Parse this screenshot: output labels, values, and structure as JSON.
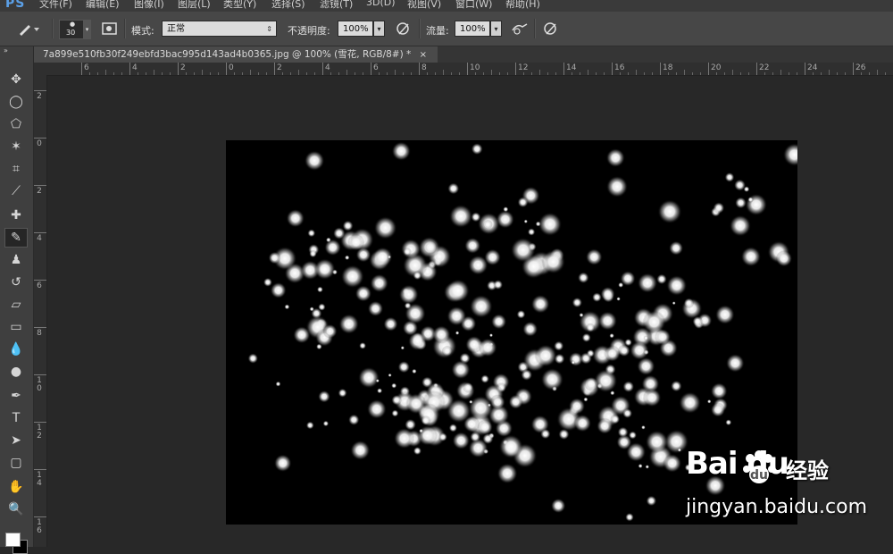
{
  "app": {
    "logo": "PS"
  },
  "menu": [
    {
      "label": "文件(F)"
    },
    {
      "label": "编辑(E)"
    },
    {
      "label": "图像(I)"
    },
    {
      "label": "图层(L)"
    },
    {
      "label": "类型(Y)"
    },
    {
      "label": "选择(S)"
    },
    {
      "label": "滤镜(T)"
    },
    {
      "label": "3D(D)"
    },
    {
      "label": "视图(V)"
    },
    {
      "label": "窗口(W)"
    },
    {
      "label": "帮助(H)"
    }
  ],
  "options": {
    "brush_size": "30",
    "mode_label": "模式:",
    "mode_value": "正常",
    "opacity_label": "不透明度:",
    "opacity_value": "100%",
    "flow_label": "流量:",
    "flow_value": "100%"
  },
  "document_tab": {
    "title": "7a899e510fb30f249ebfd3bac995d143ad4b0365.jpg @ 100% (雪花, RGB/8#) *",
    "close": "×"
  },
  "toolbar": {
    "collapse": "»",
    "tools": [
      {
        "name": "move-tool",
        "glyph": "✥"
      },
      {
        "name": "elliptical-marquee-tool",
        "glyph": "◯"
      },
      {
        "name": "polygonal-lasso-tool",
        "glyph": "⬠"
      },
      {
        "name": "magic-wand-tool",
        "glyph": "✶"
      },
      {
        "name": "crop-tool",
        "glyph": "⌗"
      },
      {
        "name": "eyedropper-tool",
        "glyph": "⟋"
      },
      {
        "name": "spot-healing-tool",
        "glyph": "✚"
      },
      {
        "name": "brush-tool",
        "glyph": "✎"
      },
      {
        "name": "clone-stamp-tool",
        "glyph": "♟"
      },
      {
        "name": "history-brush-tool",
        "glyph": "↺"
      },
      {
        "name": "eraser-tool",
        "glyph": "▱"
      },
      {
        "name": "gradient-tool",
        "glyph": "▭"
      },
      {
        "name": "blur-tool",
        "glyph": "💧"
      },
      {
        "name": "dodge-tool",
        "glyph": "●"
      },
      {
        "name": "pen-tool",
        "glyph": "✒"
      },
      {
        "name": "type-tool",
        "glyph": "T"
      },
      {
        "name": "path-selection-tool",
        "glyph": "➤"
      },
      {
        "name": "rectangle-tool",
        "glyph": "▢"
      },
      {
        "name": "hand-tool",
        "glyph": "✋"
      },
      {
        "name": "zoom-tool",
        "glyph": "🔍"
      }
    ],
    "active_tool": "brush-tool",
    "foreground_color": "#ffffff",
    "background_color": "#000000"
  },
  "ruler_h": [
    "6",
    "4",
    "2",
    "0",
    "2",
    "4",
    "6",
    "8",
    "10",
    "12",
    "14",
    "16",
    "18",
    "20",
    "22",
    "24",
    "26"
  ],
  "ruler_v": [
    "2",
    "0",
    "2",
    "4",
    "6",
    "8",
    "10",
    "12",
    "14",
    "16"
  ],
  "image": {
    "description_colors": {
      "background": "#000000",
      "snow": "#ffffff"
    },
    "snow_seed": 7
  },
  "watermark": {
    "brand": "Bai  du",
    "product": "经验",
    "url": "jingyan.baidu.com"
  }
}
